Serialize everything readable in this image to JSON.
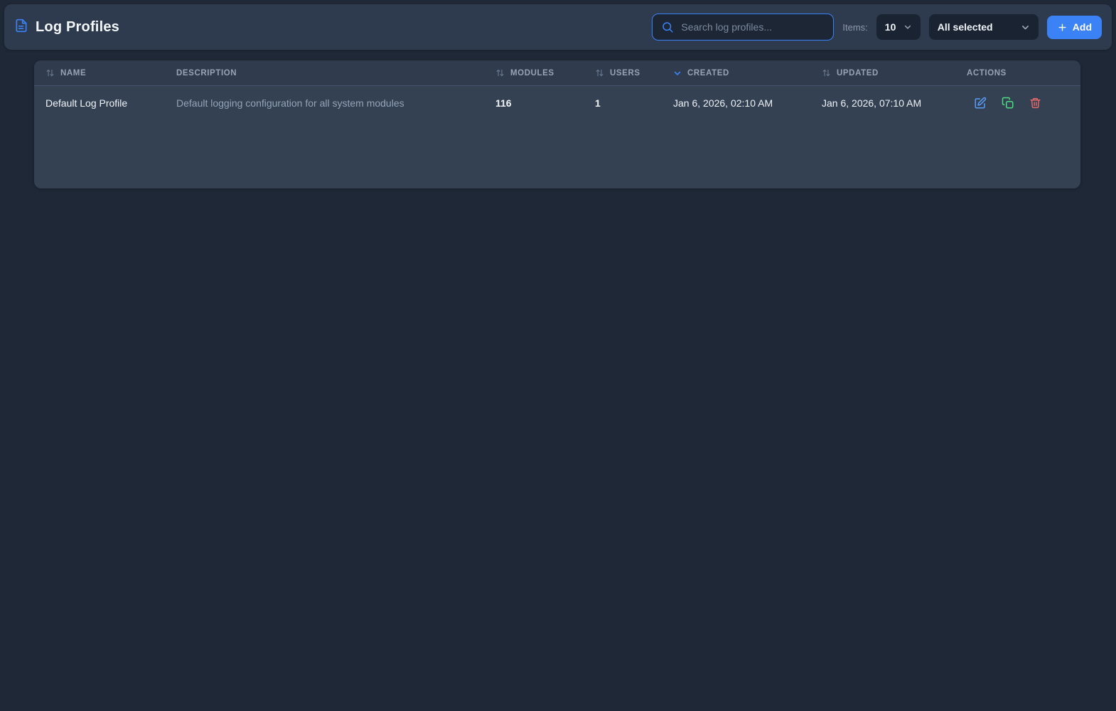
{
  "page": {
    "title": "Log Profiles"
  },
  "toolbar": {
    "search_placeholder": "Search log profiles...",
    "search_value": "",
    "items_label": "Items:",
    "items_per_page": "10",
    "filter_selected": "All selected",
    "add_label": "Add"
  },
  "table": {
    "columns": [
      {
        "label": "NAME",
        "sortable": true
      },
      {
        "label": "DESCRIPTION",
        "sortable": false
      },
      {
        "label": "MODULES",
        "sortable": true
      },
      {
        "label": "USERS",
        "sortable": true
      },
      {
        "label": "CREATED",
        "sortable": true,
        "sorted": "desc"
      },
      {
        "label": "UPDATED",
        "sortable": true
      },
      {
        "label": "ACTIONS",
        "sortable": false
      }
    ],
    "rows": [
      {
        "name": "Default Log Profile",
        "description": "Default logging configuration for all system modules",
        "modules": "116",
        "users": "1",
        "created": "Jan 6, 2026, 02:10 AM",
        "updated": "Jan 6, 2026, 07:10 AM"
      }
    ]
  },
  "icons": {
    "file-text-icon": "document with text lines",
    "search-icon": "magnifier",
    "chevron-down-icon": "v chevron",
    "sort-icon": "up-down arrows",
    "plus-icon": "+",
    "edit-icon": "pencil in square",
    "copy-icon": "overlapping squares",
    "trash-icon": "trash can"
  },
  "colors": {
    "page_bg": "#1e2836",
    "header_bg": "#2e3a4e",
    "panel_bg": "#344153",
    "panel_header_bg": "#303c4e",
    "accent_blue": "#3b82f6",
    "edit_blue": "#5b9cf6",
    "copy_green": "#4ade80",
    "delete_red": "#e96b6b",
    "muted_text": "#94a3b8"
  }
}
